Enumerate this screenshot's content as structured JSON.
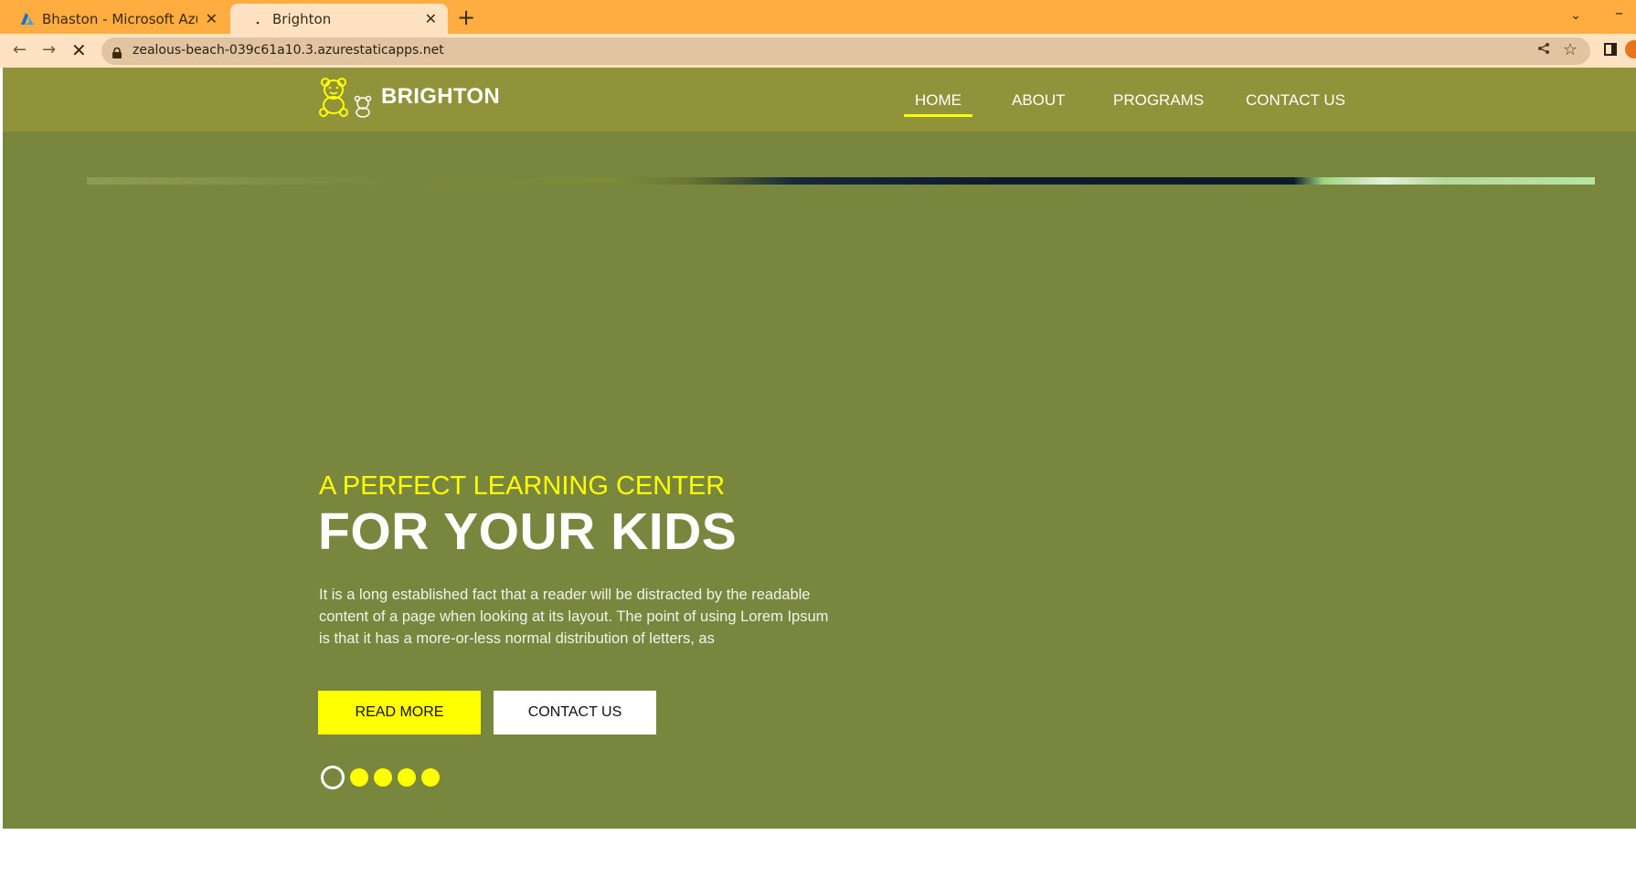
{
  "browser": {
    "tabs": [
      {
        "title": "Bhaston - Microsoft Azure",
        "icon": "azure-logo-icon",
        "active": false
      },
      {
        "title": "Brighton",
        "icon": "loading-dot-icon",
        "active": true
      }
    ],
    "url": "zealous-beach-039c61a10.3.azurestaticapps.net",
    "loading": true
  },
  "header": {
    "brand": "BRIGHTON",
    "nav": [
      {
        "label": "HOME",
        "active": true
      },
      {
        "label": "ABOUT",
        "active": false
      },
      {
        "label": "PROGRAMS",
        "active": false
      },
      {
        "label": "CONTACT US",
        "active": false
      }
    ]
  },
  "hero": {
    "kicker": "A PERFECT LEARNING CENTER",
    "title": "FOR YOUR KIDS",
    "text": "It is a long established fact that a reader will be distracted by the readable content of a page when looking at its layout. The point of using Lorem Ipsum is that it has a more-or-less normal distribution of letters, as",
    "buttons": {
      "read_more": "READ MORE",
      "contact": "CONTACT US"
    },
    "slides": {
      "count": 5,
      "active_index": 0
    }
  },
  "colors": {
    "tab_strip": "#ffac41",
    "toolbar": "#ffe2c2",
    "header_bg": "#909339",
    "hero_bg": "#79863e",
    "accent_yellow": "#ffff00"
  }
}
